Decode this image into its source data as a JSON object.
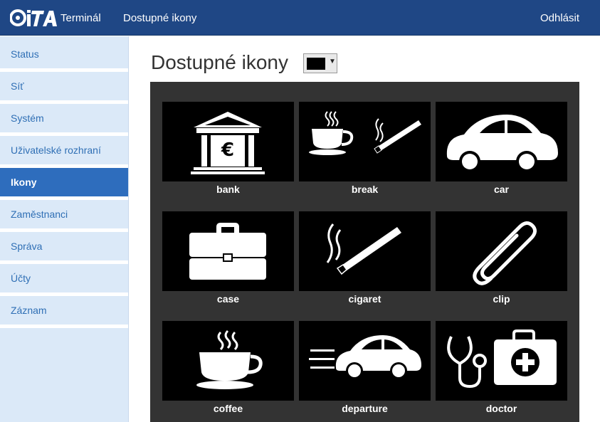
{
  "header": {
    "brand_text": "Terminál",
    "nav_label": "Dostupné ikony",
    "logout_label": "Odhlásit"
  },
  "sidebar": {
    "items": [
      {
        "label": "Status"
      },
      {
        "label": "Síť"
      },
      {
        "label": "Systém"
      },
      {
        "label": "Uživatelské rozhraní"
      },
      {
        "label": "Ikony",
        "active": true
      },
      {
        "label": "Zaměstnanci"
      },
      {
        "label": "Správa"
      },
      {
        "label": "Účty"
      },
      {
        "label": "Záznam"
      }
    ]
  },
  "main": {
    "title": "Dostupné ikony",
    "color_select": {
      "value": "#000000"
    }
  },
  "icons": [
    {
      "label": "bank",
      "icon": "bank-icon"
    },
    {
      "label": "break",
      "icon": "break-icon"
    },
    {
      "label": "car",
      "icon": "car-icon"
    },
    {
      "label": "case",
      "icon": "case-icon"
    },
    {
      "label": "cigaret",
      "icon": "cigaret-icon"
    },
    {
      "label": "clip",
      "icon": "clip-icon"
    },
    {
      "label": "coffee",
      "icon": "coffee-icon"
    },
    {
      "label": "departure",
      "icon": "departure-icon"
    },
    {
      "label": "doctor",
      "icon": "doctor-icon"
    }
  ],
  "colors": {
    "header_bg": "#1f4785",
    "sidebar_bg": "#dbe9f8",
    "sidebar_active": "#2e6dbd",
    "panel_bg": "#333333"
  }
}
